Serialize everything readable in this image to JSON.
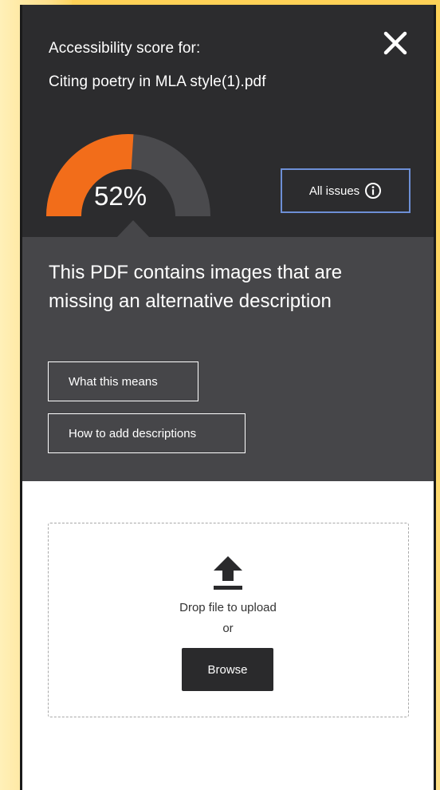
{
  "panel": {
    "title_prefix": "Accessibility score for:",
    "file_name": "Citing poetry in MLA style(1).pdf",
    "close_icon": "close-icon"
  },
  "score": {
    "value_text": "52%",
    "percent": 52,
    "fill_color": "#f26d1a",
    "track_color": "#4a4a4d"
  },
  "all_issues": {
    "label": "All issues",
    "icon": "info-icon"
  },
  "issue": {
    "message": "This PDF contains images that are missing an alternative description",
    "what_this_means_label": "What this means",
    "how_to_add_label": "How to add descriptions"
  },
  "upload": {
    "icon": "upload-icon",
    "drop_text": "Drop file to upload",
    "or_text": "or",
    "browse_label": "Browse"
  },
  "colors": {
    "header_bg": "#2c2c2e",
    "message_bg": "#464649",
    "accent_border": "#6d8fd6",
    "page_bg": "#ffd257"
  }
}
